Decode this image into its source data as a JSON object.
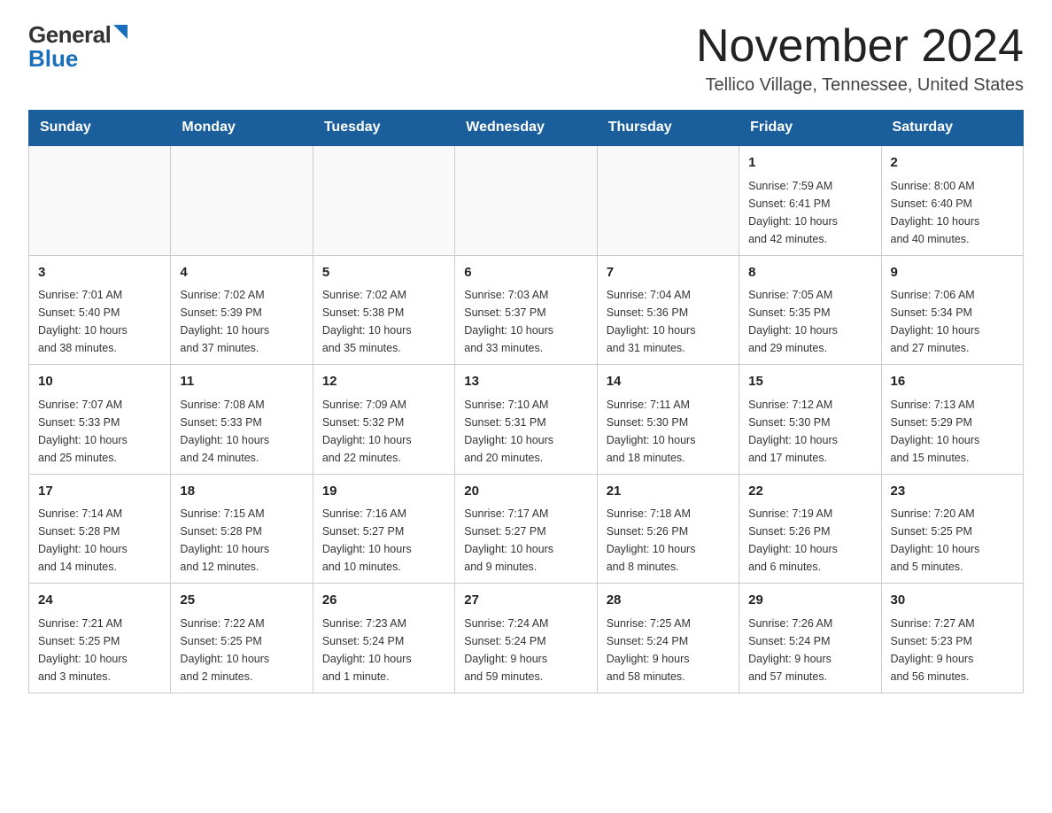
{
  "header": {
    "logo_line1": "General",
    "logo_line2": "Blue",
    "month_title": "November 2024",
    "location": "Tellico Village, Tennessee, United States"
  },
  "calendar": {
    "days_of_week": [
      "Sunday",
      "Monday",
      "Tuesday",
      "Wednesday",
      "Thursday",
      "Friday",
      "Saturday"
    ],
    "weeks": [
      [
        {
          "day": "",
          "info": ""
        },
        {
          "day": "",
          "info": ""
        },
        {
          "day": "",
          "info": ""
        },
        {
          "day": "",
          "info": ""
        },
        {
          "day": "",
          "info": ""
        },
        {
          "day": "1",
          "info": "Sunrise: 7:59 AM\nSunset: 6:41 PM\nDaylight: 10 hours\nand 42 minutes."
        },
        {
          "day": "2",
          "info": "Sunrise: 8:00 AM\nSunset: 6:40 PM\nDaylight: 10 hours\nand 40 minutes."
        }
      ],
      [
        {
          "day": "3",
          "info": "Sunrise: 7:01 AM\nSunset: 5:40 PM\nDaylight: 10 hours\nand 38 minutes."
        },
        {
          "day": "4",
          "info": "Sunrise: 7:02 AM\nSunset: 5:39 PM\nDaylight: 10 hours\nand 37 minutes."
        },
        {
          "day": "5",
          "info": "Sunrise: 7:02 AM\nSunset: 5:38 PM\nDaylight: 10 hours\nand 35 minutes."
        },
        {
          "day": "6",
          "info": "Sunrise: 7:03 AM\nSunset: 5:37 PM\nDaylight: 10 hours\nand 33 minutes."
        },
        {
          "day": "7",
          "info": "Sunrise: 7:04 AM\nSunset: 5:36 PM\nDaylight: 10 hours\nand 31 minutes."
        },
        {
          "day": "8",
          "info": "Sunrise: 7:05 AM\nSunset: 5:35 PM\nDaylight: 10 hours\nand 29 minutes."
        },
        {
          "day": "9",
          "info": "Sunrise: 7:06 AM\nSunset: 5:34 PM\nDaylight: 10 hours\nand 27 minutes."
        }
      ],
      [
        {
          "day": "10",
          "info": "Sunrise: 7:07 AM\nSunset: 5:33 PM\nDaylight: 10 hours\nand 25 minutes."
        },
        {
          "day": "11",
          "info": "Sunrise: 7:08 AM\nSunset: 5:33 PM\nDaylight: 10 hours\nand 24 minutes."
        },
        {
          "day": "12",
          "info": "Sunrise: 7:09 AM\nSunset: 5:32 PM\nDaylight: 10 hours\nand 22 minutes."
        },
        {
          "day": "13",
          "info": "Sunrise: 7:10 AM\nSunset: 5:31 PM\nDaylight: 10 hours\nand 20 minutes."
        },
        {
          "day": "14",
          "info": "Sunrise: 7:11 AM\nSunset: 5:30 PM\nDaylight: 10 hours\nand 18 minutes."
        },
        {
          "day": "15",
          "info": "Sunrise: 7:12 AM\nSunset: 5:30 PM\nDaylight: 10 hours\nand 17 minutes."
        },
        {
          "day": "16",
          "info": "Sunrise: 7:13 AM\nSunset: 5:29 PM\nDaylight: 10 hours\nand 15 minutes."
        }
      ],
      [
        {
          "day": "17",
          "info": "Sunrise: 7:14 AM\nSunset: 5:28 PM\nDaylight: 10 hours\nand 14 minutes."
        },
        {
          "day": "18",
          "info": "Sunrise: 7:15 AM\nSunset: 5:28 PM\nDaylight: 10 hours\nand 12 minutes."
        },
        {
          "day": "19",
          "info": "Sunrise: 7:16 AM\nSunset: 5:27 PM\nDaylight: 10 hours\nand 10 minutes."
        },
        {
          "day": "20",
          "info": "Sunrise: 7:17 AM\nSunset: 5:27 PM\nDaylight: 10 hours\nand 9 minutes."
        },
        {
          "day": "21",
          "info": "Sunrise: 7:18 AM\nSunset: 5:26 PM\nDaylight: 10 hours\nand 8 minutes."
        },
        {
          "day": "22",
          "info": "Sunrise: 7:19 AM\nSunset: 5:26 PM\nDaylight: 10 hours\nand 6 minutes."
        },
        {
          "day": "23",
          "info": "Sunrise: 7:20 AM\nSunset: 5:25 PM\nDaylight: 10 hours\nand 5 minutes."
        }
      ],
      [
        {
          "day": "24",
          "info": "Sunrise: 7:21 AM\nSunset: 5:25 PM\nDaylight: 10 hours\nand 3 minutes."
        },
        {
          "day": "25",
          "info": "Sunrise: 7:22 AM\nSunset: 5:25 PM\nDaylight: 10 hours\nand 2 minutes."
        },
        {
          "day": "26",
          "info": "Sunrise: 7:23 AM\nSunset: 5:24 PM\nDaylight: 10 hours\nand 1 minute."
        },
        {
          "day": "27",
          "info": "Sunrise: 7:24 AM\nSunset: 5:24 PM\nDaylight: 9 hours\nand 59 minutes."
        },
        {
          "day": "28",
          "info": "Sunrise: 7:25 AM\nSunset: 5:24 PM\nDaylight: 9 hours\nand 58 minutes."
        },
        {
          "day": "29",
          "info": "Sunrise: 7:26 AM\nSunset: 5:24 PM\nDaylight: 9 hours\nand 57 minutes."
        },
        {
          "day": "30",
          "info": "Sunrise: 7:27 AM\nSunset: 5:23 PM\nDaylight: 9 hours\nand 56 minutes."
        }
      ]
    ]
  }
}
